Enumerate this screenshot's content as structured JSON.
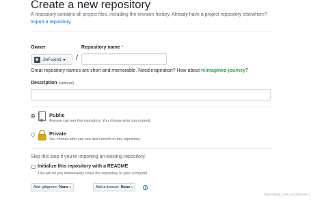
{
  "header": {
    "title": "Create a new repository",
    "subtitle": "A repository contains all project files, including the revision history. Already have a project repository elsewhere?",
    "import_link": "Import a repository."
  },
  "owner": {
    "label": "Owner",
    "value": "JinFuxin1"
  },
  "repo_name": {
    "label": "Repository name",
    "required_mark": "*",
    "value": "",
    "slash": "/"
  },
  "hint": {
    "text": "Great repository names are short and memorable. Need inspiration? How about",
    "suggestion": "reimagined-journey",
    "suffix": "?"
  },
  "description": {
    "label": "Description",
    "optional": "(optional)",
    "value": ""
  },
  "visibility": {
    "public": {
      "title": "Public",
      "desc": "Anyone can see this repository. You choose who can commit.",
      "selected": true
    },
    "private": {
      "title": "Private",
      "desc": "You choose who can see and commit to this repository.",
      "selected": false
    }
  },
  "init": {
    "skip_text": "Skip this step if you're importing an existing repository.",
    "readme_label": "Initialize this repository with a README",
    "readme_desc": "This will let you immediately clone the repository to your computer.",
    "readme_checked": false
  },
  "gitignore": {
    "label": "Add .gitignore:",
    "value": "None"
  },
  "license": {
    "label": "Add a license:",
    "value": "None"
  },
  "info_icon_glyph": "i",
  "colors": {
    "link": "#0366d6",
    "suggestion": "#28a745",
    "required": "#cb2431"
  },
  "watermark": "https://blog.csdn.net/JinFuxin1"
}
